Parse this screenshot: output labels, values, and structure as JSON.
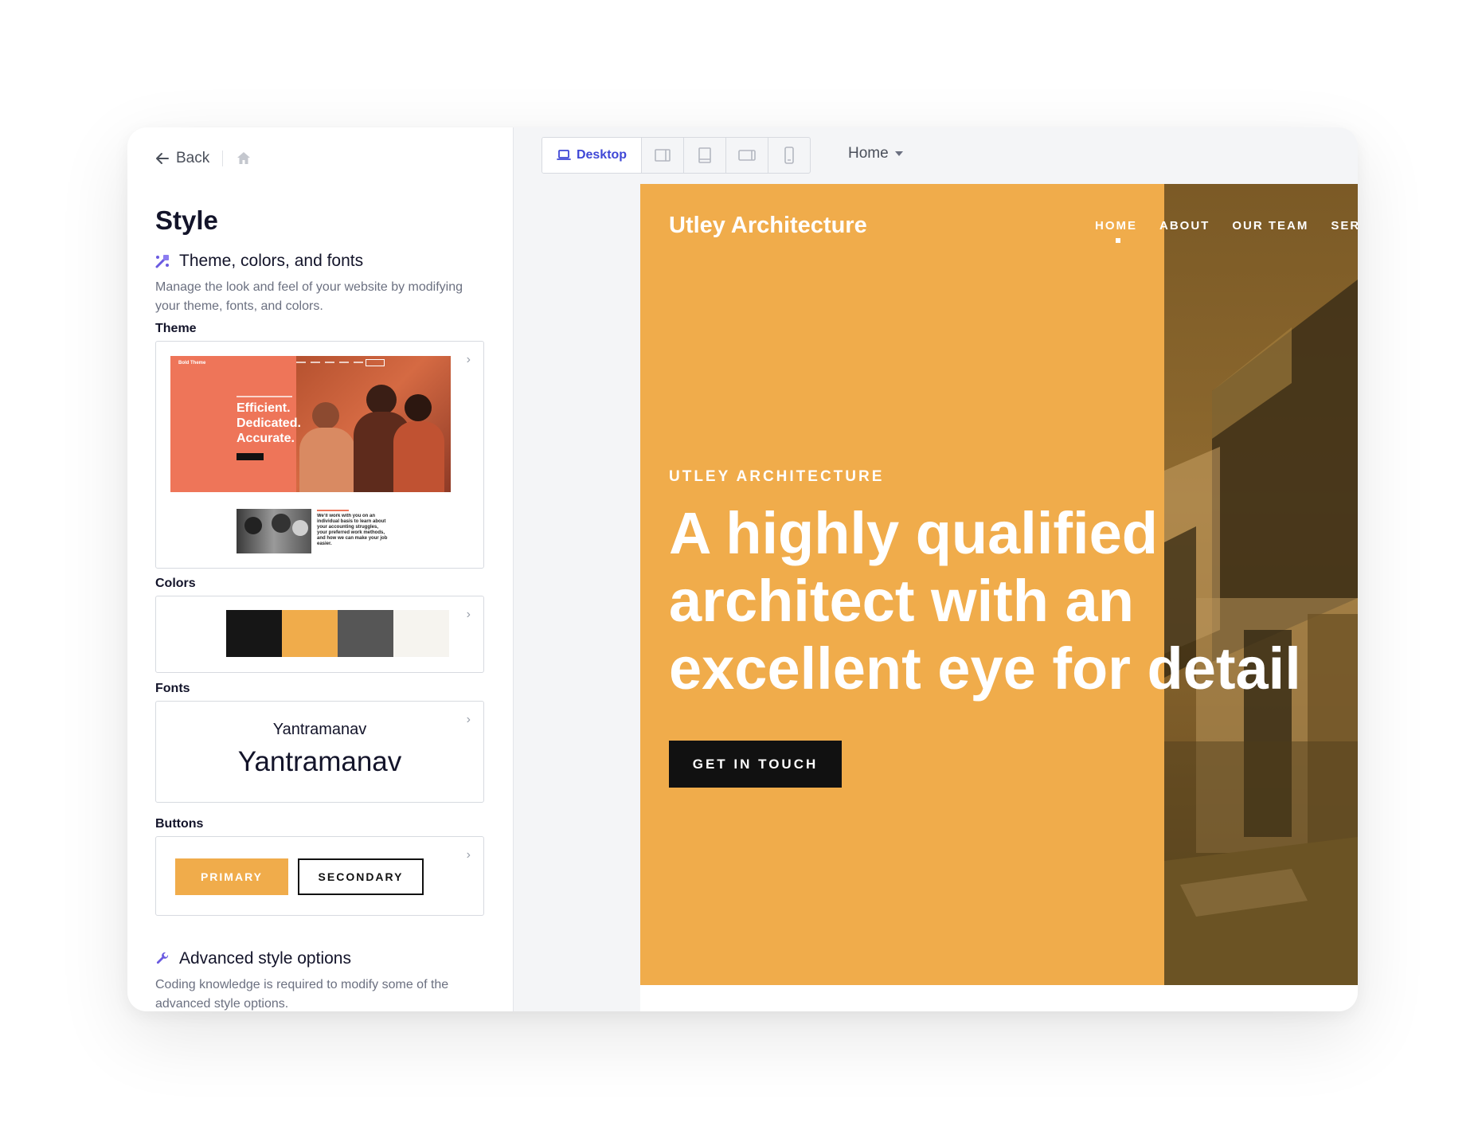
{
  "sidebar": {
    "back_label": "Back",
    "title": "Style",
    "theme_section": {
      "heading": "Theme, colors, and fonts",
      "description": "Manage the look and feel of your website by modifying your theme, fonts, and colors."
    },
    "theme": {
      "label": "Theme",
      "preview_logo": "Bold Theme",
      "preview_headline": "Efficient. Dedicated. Accurate.",
      "preview_body": "We'll work with you on an individual basis to learn about your accounting struggles, your preferred work methods, and how we can make your job easier."
    },
    "colors": {
      "label": "Colors",
      "swatches": [
        "#161616",
        "#f0ac4b",
        "#565656",
        "#f6f4ef"
      ]
    },
    "fonts": {
      "label": "Fonts",
      "body_font": "Yantramanav",
      "heading_font": "Yantramanav"
    },
    "buttons": {
      "label": "Buttons",
      "primary": "PRIMARY",
      "secondary": "SECONDARY"
    },
    "advanced": {
      "heading": "Advanced style options",
      "description": "Coding knowledge is required to modify some of the advanced style options."
    }
  },
  "toolbar": {
    "desktop_label": "Desktop",
    "devices": [
      "laptop-icon",
      "tablet-landscape-icon",
      "tablet-icon",
      "wide-tablet-icon",
      "mobile-icon"
    ],
    "page_selector": "Home"
  },
  "preview": {
    "site_name": "Utley Architecture",
    "nav": [
      "HOME",
      "ABOUT",
      "OUR TEAM",
      "SERV"
    ],
    "eyebrow": "UTLEY ARCHITECTURE",
    "headline": "A highly qualified architect with an excellent eye for detail",
    "cta": "GET IN TOUCH",
    "accent_color": "#f0ac4b"
  }
}
